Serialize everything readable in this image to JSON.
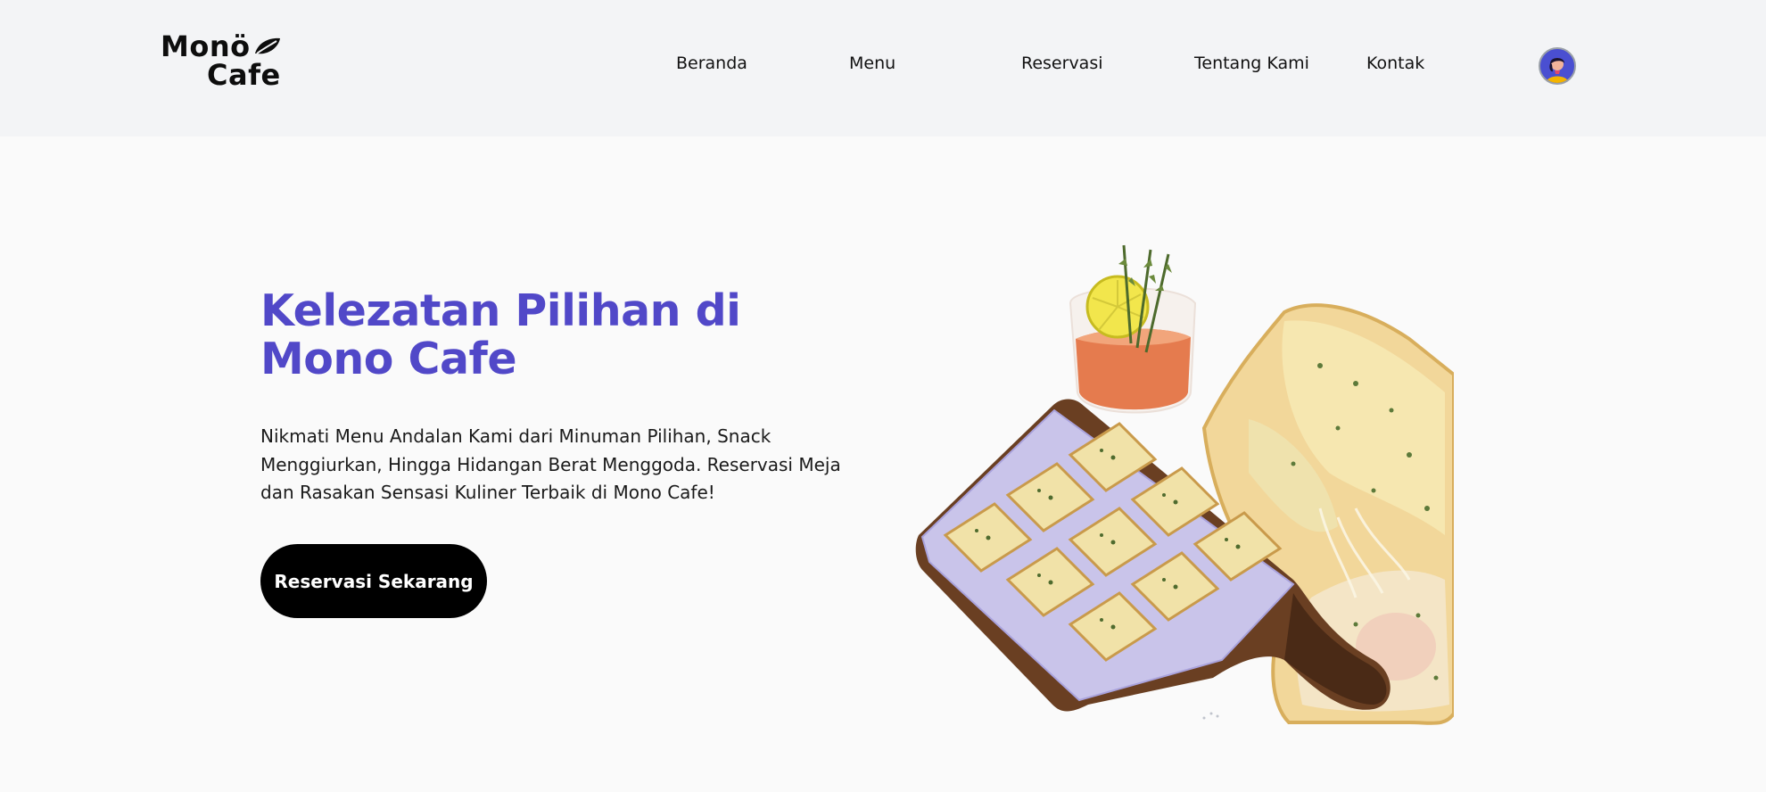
{
  "brand": {
    "line1": "Monö",
    "line2": "Cafe",
    "logo_icon": "leaf-icon"
  },
  "nav": {
    "items": [
      {
        "label": "Beranda"
      },
      {
        "label": "Menu"
      },
      {
        "label": "Reservasi"
      },
      {
        "label": "Tentang Kami"
      },
      {
        "label": "Kontak"
      }
    ],
    "avatar_icon": "user-avatar-icon"
  },
  "hero": {
    "title": "Kelezatan Pilihan di Mono Cafe",
    "description": "Nikmati Menu Andalan Kami dari Minuman Pilihan, Snack Menggiurkan, Hingga Hidangan Berat Menggoda. Reservasi Meja dan Rasakan Sensasi Kuliner Terbaik di Mono Cafe!",
    "cta_label": "Reservasi Sekarang",
    "image": "food-illustration"
  },
  "colors": {
    "accent": "#5148c8",
    "header_bg": "#f3f4f6",
    "page_bg": "#fafafa",
    "button_bg": "#000000"
  }
}
